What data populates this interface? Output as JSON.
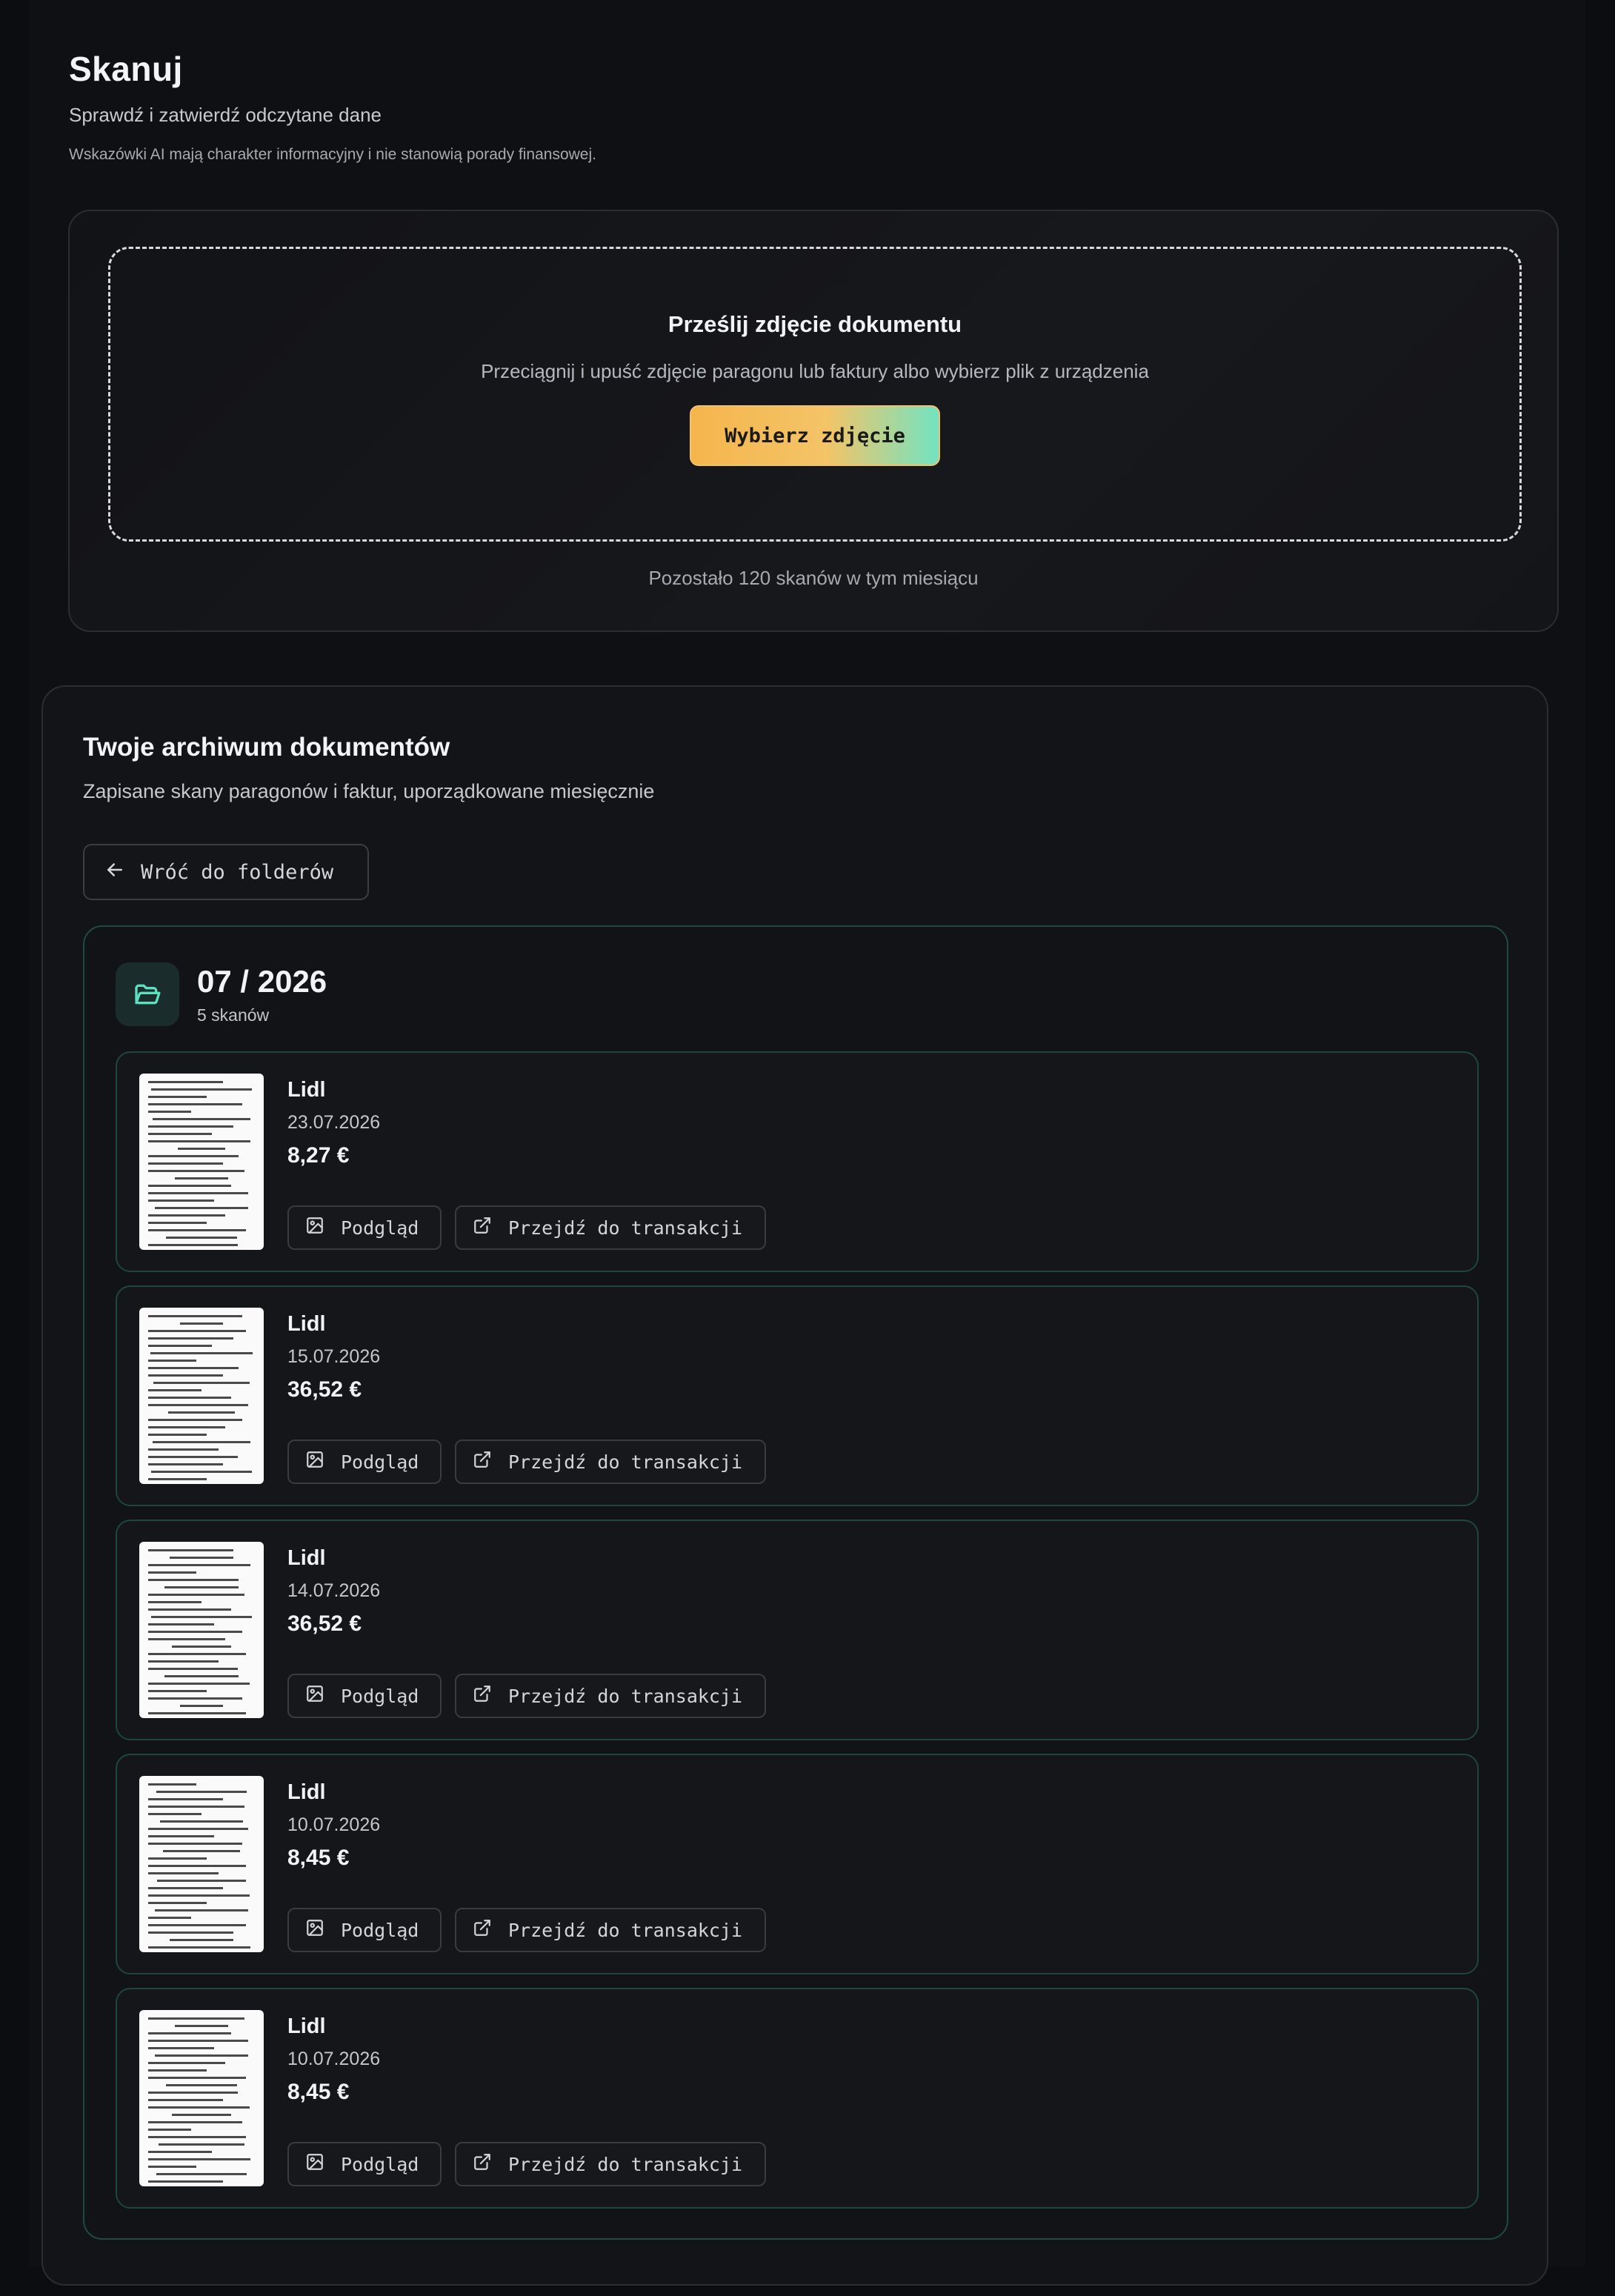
{
  "header": {
    "title": "Skanuj",
    "subtitle": "Sprawdź i zatwierdź odczytane dane",
    "disclaimer": "Wskazówki AI mają charakter informacyjny i nie stanowią porady finansowej."
  },
  "upload": {
    "title": "Prześlij zdjęcie dokumentu",
    "description": "Przeciągnij i upuść zdjęcie paragonu lub faktury albo wybierz plik z urządzenia",
    "button_label": "Wybierz zdjęcie",
    "remaining": "Pozostało 120 skanów w tym miesiącu"
  },
  "archive": {
    "title": "Twoje archiwum dokumentów",
    "subtitle": "Zapisane skany paragonów i faktur, uporządkowane miesięcznie",
    "back_label": "Wróć do folderów",
    "folder": {
      "name": "07 / 2026",
      "count": "5 skanów",
      "items": [
        {
          "store": "Lidl",
          "date": "23.07.2026",
          "amount": "8,27 €",
          "preview_label": "Podgląd",
          "goto_label": "Przejdź do transakcji"
        },
        {
          "store": "Lidl",
          "date": "15.07.2026",
          "amount": "36,52 €",
          "preview_label": "Podgląd",
          "goto_label": "Przejdź do transakcji"
        },
        {
          "store": "Lidl",
          "date": "14.07.2026",
          "amount": "36,52 €",
          "preview_label": "Podgląd",
          "goto_label": "Przejdź do transakcji"
        },
        {
          "store": "Lidl",
          "date": "10.07.2026",
          "amount": "8,45 €",
          "preview_label": "Podgląd",
          "goto_label": "Przejdź do transakcji"
        },
        {
          "store": "Lidl",
          "date": "10.07.2026",
          "amount": "8,45 €",
          "preview_label": "Podgląd",
          "goto_label": "Przejdź do transakcji"
        }
      ]
    }
  },
  "icons": {
    "back": "arrow-left-icon",
    "folder": "folder-open-icon",
    "preview": "image-icon",
    "goto": "external-link-icon"
  },
  "colors": {
    "accent_start": "#f5b54d",
    "accent_end": "#73e3c1",
    "folder_border": "#1f4a44",
    "folder_icon": "#5ee0c0"
  }
}
